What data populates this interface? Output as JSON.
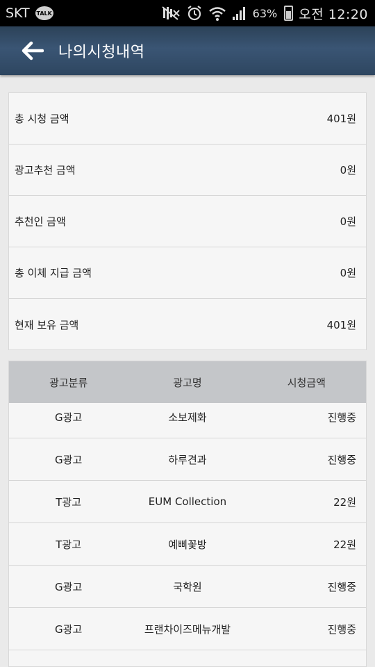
{
  "status_bar": {
    "carrier": "SKT",
    "talk_badge": "TALK",
    "battery_percent": "63%",
    "time": "오전 12:20"
  },
  "header": {
    "title": "나의시청내역"
  },
  "summary": [
    {
      "label": "총 시청 금액",
      "value": "401원"
    },
    {
      "label": "광고추천 금액",
      "value": "0원"
    },
    {
      "label": "추천인 금액",
      "value": "0원"
    },
    {
      "label": "총 이체 지급 금액",
      "value": "0원"
    },
    {
      "label": "현재 보유 금액",
      "value": "401원"
    }
  ],
  "table": {
    "headers": {
      "category": "광고분류",
      "name": "광고명",
      "amount": "시청금액"
    },
    "rows": [
      {
        "category": "G광고",
        "name": "소보제화",
        "amount": "진행중"
      },
      {
        "category": "G광고",
        "name": "하루견과",
        "amount": "진행중"
      },
      {
        "category": "T광고",
        "name": "EUM Collection",
        "amount": "22원"
      },
      {
        "category": "T광고",
        "name": "예삐꽃방",
        "amount": "22원"
      },
      {
        "category": "G광고",
        "name": "국학원",
        "amount": "진행중"
      },
      {
        "category": "G광고",
        "name": "프랜차이즈메뉴개발",
        "amount": "진행중"
      }
    ]
  },
  "colors": {
    "header_bg": "#34506c",
    "table_header_bg": "#c4c6c9",
    "page_bg": "#eaeaea"
  }
}
